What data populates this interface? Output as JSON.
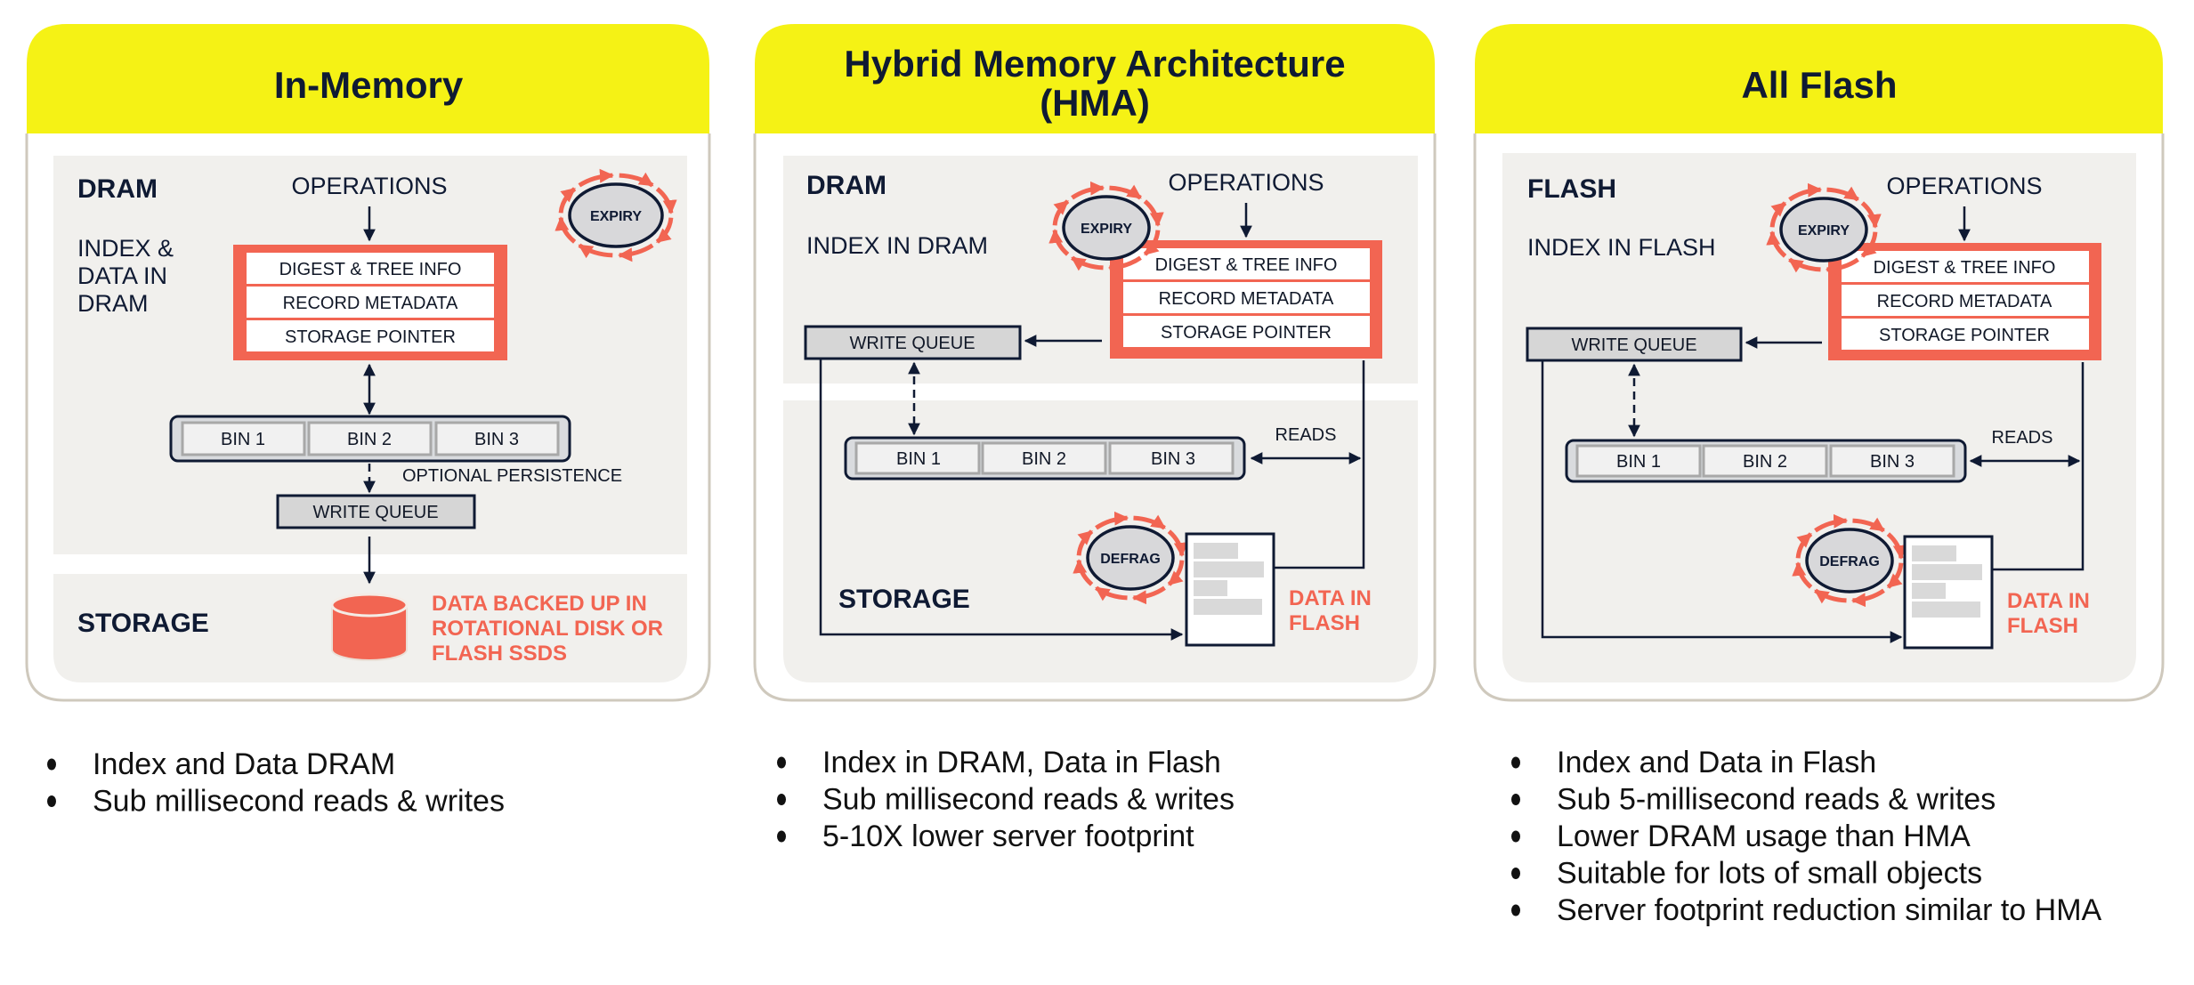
{
  "colors": {
    "header_yellow": "#f5f215",
    "panel_border": "#cfc9bd",
    "zone_gray": "#f1f0ed",
    "accent_red": "#f26552",
    "ink": "#0f1a33",
    "box_gray": "#d6d6d6"
  },
  "panels": [
    {
      "title_lines": [
        "In-Memory"
      ],
      "upper_zone": "DRAM",
      "upper_desc": [
        "INDEX &",
        "DATA IN",
        "DRAM"
      ],
      "operations": "OPERATIONS",
      "index_rows": [
        "DIGEST & TREE INFO",
        "RECORD METADATA",
        "STORAGE POINTER"
      ],
      "expiry": "EXPIRY",
      "bins": [
        "BIN 1",
        "BIN 2",
        "BIN 3"
      ],
      "optional_persistence": "OPTIONAL PERSISTENCE",
      "write_queue": "WRITE QUEUE",
      "lower_zone": "STORAGE",
      "storage_desc": [
        "DATA BACKED UP IN",
        "ROTATIONAL DISK OR",
        "FLASH SSDS"
      ],
      "bullets": [
        "Index and Data DRAM",
        "Sub millisecond reads & writes"
      ]
    },
    {
      "title_lines": [
        "Hybrid Memory Architecture",
        "(HMA)"
      ],
      "upper_zone": "DRAM",
      "upper_desc": [
        "INDEX IN DRAM"
      ],
      "operations": "OPERATIONS",
      "index_rows": [
        "DIGEST & TREE INFO",
        "RECORD METADATA",
        "STORAGE POINTER"
      ],
      "expiry": "EXPIRY",
      "write_queue": "WRITE QUEUE",
      "bins": [
        "BIN 1",
        "BIN 2",
        "BIN 3"
      ],
      "reads": "READS",
      "defrag": "DEFRAG",
      "lower_zone": "STORAGE",
      "data_label": [
        "DATA IN",
        "FLASH"
      ],
      "bullets": [
        "Index in DRAM, Data in Flash",
        "Sub millisecond reads & writes",
        "5-10X lower server footprint"
      ]
    },
    {
      "title_lines": [
        "All Flash"
      ],
      "upper_zone": "FLASH",
      "upper_desc": [
        "INDEX IN FLASH"
      ],
      "operations": "OPERATIONS",
      "index_rows": [
        "DIGEST & TREE INFO",
        "RECORD METADATA",
        "STORAGE POINTER"
      ],
      "expiry": "EXPIRY",
      "write_queue": "WRITE QUEUE",
      "bins": [
        "BIN 1",
        "BIN 2",
        "BIN 3"
      ],
      "reads": "READS",
      "defrag": "DEFRAG",
      "data_label": [
        "DATA IN",
        "FLASH"
      ],
      "bullets": [
        "Index and Data in Flash",
        "Sub 5-millisecond reads & writes",
        "Lower DRAM usage than HMA",
        "Suitable for lots of small objects",
        "Server footprint reduction similar to HMA"
      ]
    }
  ]
}
